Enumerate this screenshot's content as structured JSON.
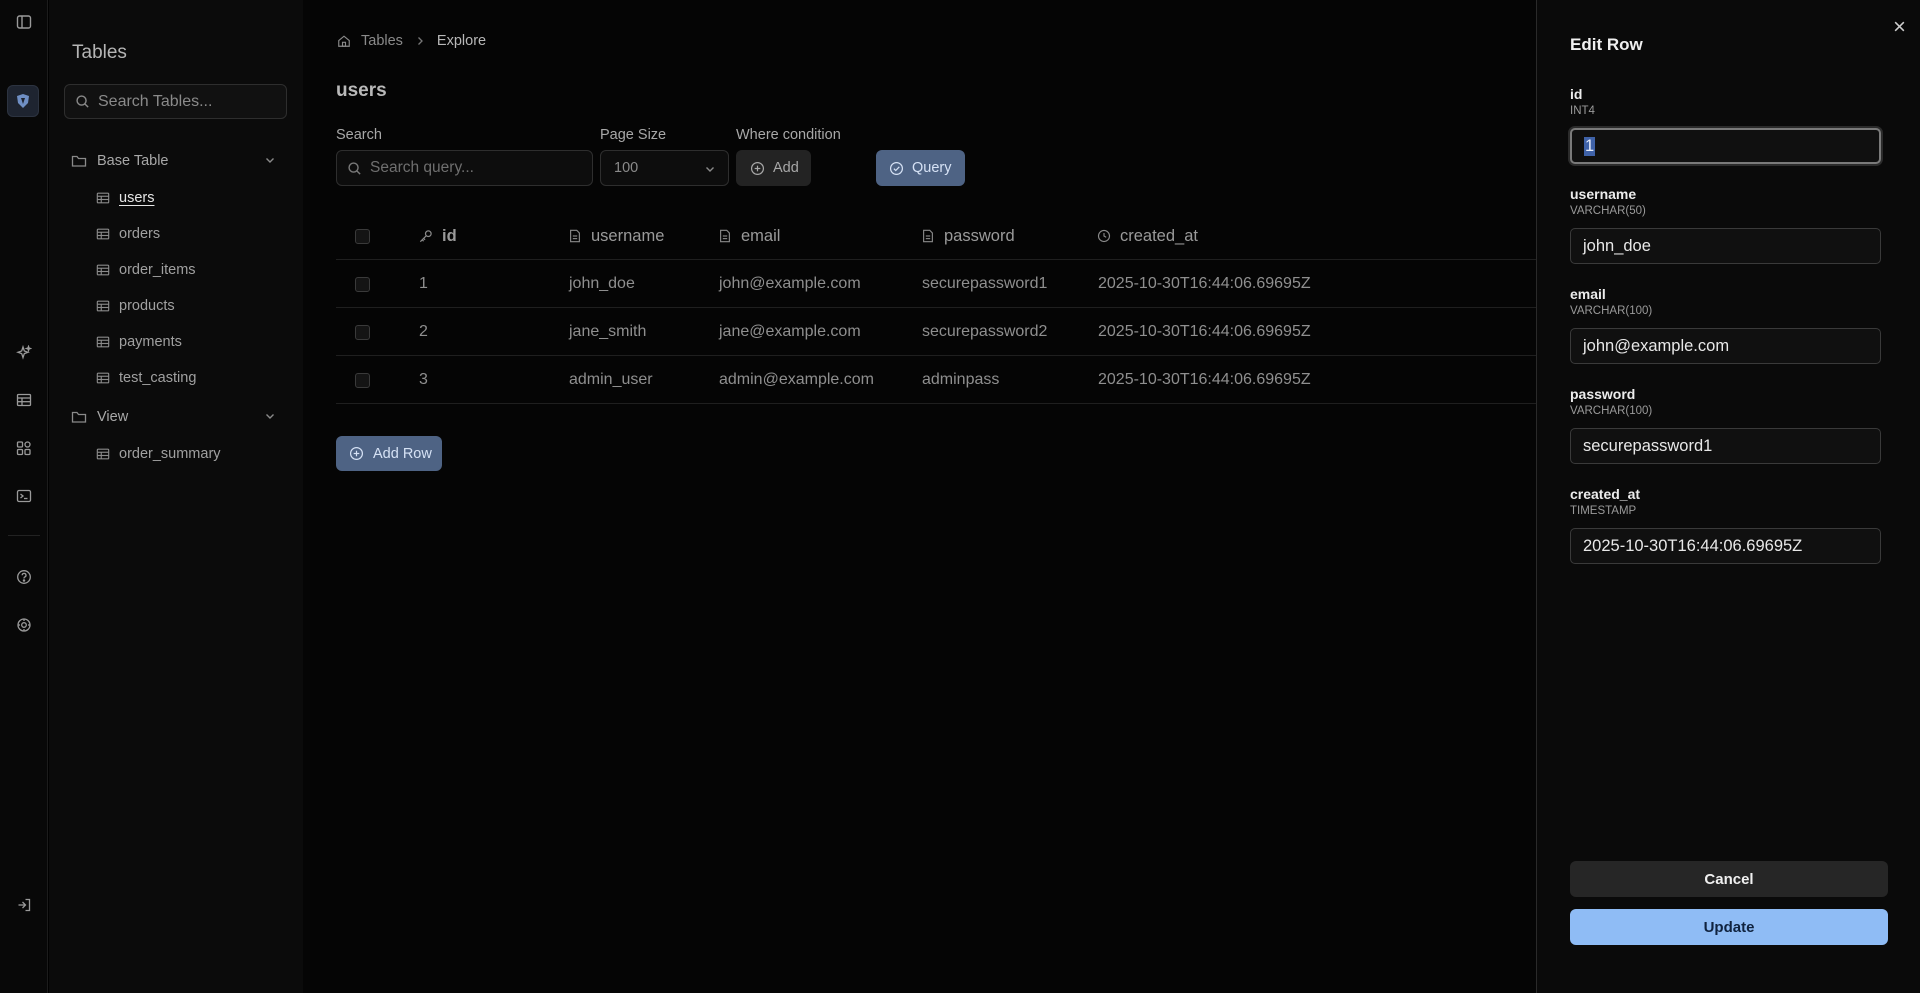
{
  "rail": {
    "icons": [
      "sidebar-toggle-icon",
      "logo",
      "sparkles-icon",
      "table-icon",
      "shapes-icon",
      "terminal-icon",
      "help-icon",
      "settings-icon",
      "logout-icon"
    ]
  },
  "sidebar": {
    "title": "Tables",
    "search_placeholder": "Search Tables...",
    "folders": [
      {
        "label": "Base Table",
        "items": [
          "users",
          "orders",
          "order_items",
          "products",
          "payments",
          "test_casting"
        ]
      },
      {
        "label": "View",
        "items": [
          "order_summary"
        ]
      }
    ],
    "active_item": "users"
  },
  "main": {
    "breadcrumb": {
      "root": "Tables",
      "current": "Explore"
    },
    "title": "users",
    "search": {
      "label": "Search",
      "placeholder": "Search query..."
    },
    "page_size": {
      "label": "Page Size",
      "value": "100"
    },
    "where": {
      "label": "Where condition",
      "add_label": "Add"
    },
    "query_label": "Query",
    "add_row_label": "Add Row",
    "table": {
      "columns": [
        "id",
        "username",
        "email",
        "password",
        "created_at"
      ],
      "rows": [
        [
          "1",
          "john_doe",
          "john@example.com",
          "securepassword1",
          "2025-10-30T16:44:06.69695Z"
        ],
        [
          "2",
          "jane_smith",
          "jane@example.com",
          "securepassword2",
          "2025-10-30T16:44:06.69695Z"
        ],
        [
          "3",
          "admin_user",
          "admin@example.com",
          "adminpass",
          "2025-10-30T16:44:06.69695Z"
        ]
      ]
    }
  },
  "panel": {
    "title": "Edit Row",
    "fields": [
      {
        "name": "id",
        "type": "INT4",
        "value": "1"
      },
      {
        "name": "username",
        "type": "VARCHAR(50)",
        "value": "john_doe"
      },
      {
        "name": "email",
        "type": "VARCHAR(100)",
        "value": "john@example.com"
      },
      {
        "name": "password",
        "type": "VARCHAR(100)",
        "value": "securepassword1"
      },
      {
        "name": "created_at",
        "type": "TIMESTAMP",
        "value": "2025-10-30T16:44:06.69695Z"
      }
    ],
    "cancel_label": "Cancel",
    "update_label": "Update"
  },
  "colors": {
    "accent": "#8fbcf5",
    "button_blue": "#4e6384",
    "background": "#000000"
  }
}
